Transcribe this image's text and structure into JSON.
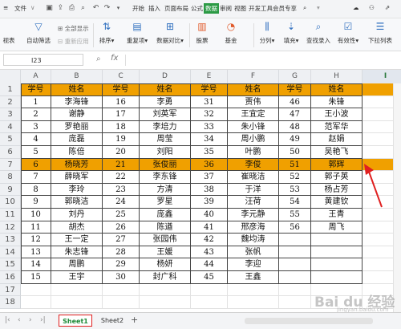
{
  "menubar": {
    "file": "文件",
    "tabs": [
      "开始",
      "插入",
      "页面布局",
      "公式",
      "数据",
      "审阅",
      "视图",
      "开发工具",
      "会员专享"
    ],
    "active_tab": "数据"
  },
  "ribbon": {
    "left_cut": "视表",
    "items": [
      {
        "label": "自动筛选",
        "icon": "filter-icon"
      },
      {
        "label": "排序",
        "icon": "sort-icon"
      },
      {
        "label": "重复项",
        "icon": "duplicate-icon"
      },
      {
        "label": "数据对比",
        "icon": "compare-icon"
      },
      {
        "label": "股票",
        "icon": "stock-icon"
      },
      {
        "label": "基金",
        "icon": "fund-icon"
      },
      {
        "label": "分列",
        "icon": "split-icon"
      },
      {
        "label": "填充",
        "icon": "fill-icon"
      },
      {
        "label": "查找录入",
        "icon": "lookup-icon"
      },
      {
        "label": "有效性",
        "icon": "validity-icon"
      },
      {
        "label": "下拉列表",
        "icon": "dropdown-list-icon"
      }
    ],
    "small": {
      "show_all": "全部显示",
      "reapply": "重新应用"
    }
  },
  "formula_bar": {
    "cell_ref": "I23",
    "fx": "fx",
    "value": ""
  },
  "columns": [
    "A",
    "B",
    "C",
    "D",
    "E",
    "F",
    "G",
    "H",
    "I"
  ],
  "selected_column": "I",
  "rows": [
    "1",
    "2",
    "3",
    "4",
    "5",
    "6",
    "7",
    "8",
    "9",
    "10",
    "11",
    "12",
    "13",
    "14",
    "15",
    "16",
    "17",
    "18"
  ],
  "table": {
    "header": [
      "学号",
      "姓名",
      "学号",
      "姓名",
      "学号",
      "姓名",
      "学号",
      "姓名"
    ],
    "body": [
      [
        "1",
        "李海锋",
        "16",
        "李勇",
        "31",
        "贾伟",
        "46",
        "朱锋"
      ],
      [
        "2",
        "谢静",
        "17",
        "刘英军",
        "32",
        "王宜定",
        "47",
        "王小波"
      ],
      [
        "3",
        "罗艳丽",
        "18",
        "李培力",
        "33",
        "朱小锋",
        "48",
        "范军华"
      ],
      [
        "4",
        "庞磊",
        "19",
        "周莹",
        "34",
        "周小鹏",
        "49",
        "赵娟"
      ],
      [
        "5",
        "陈倍",
        "20",
        "刘阳",
        "35",
        "叶鹏",
        "50",
        "吴艳飞"
      ],
      [
        "6",
        "杨晓芳",
        "21",
        "张俊丽",
        "36",
        "李俊",
        "51",
        "郭辉"
      ],
      [
        "7",
        "薛晓军",
        "22",
        "李东锋",
        "37",
        "崔晓洁",
        "52",
        "郭子英"
      ],
      [
        "8",
        "李玲",
        "23",
        "方清",
        "38",
        "于洋",
        "53",
        "杨占芳"
      ],
      [
        "9",
        "郭晓洁",
        "24",
        "罗星",
        "39",
        "汪荷",
        "54",
        "黄建钦"
      ],
      [
        "10",
        "刘丹",
        "25",
        "庞鑫",
        "40",
        "李元静",
        "55",
        "王青"
      ],
      [
        "11",
        "胡杰",
        "26",
        "陈遒",
        "41",
        "邢彦海",
        "56",
        "周飞"
      ],
      [
        "12",
        "王一定",
        "27",
        "张园伟",
        "42",
        "魏均涛",
        "",
        ""
      ],
      [
        "13",
        "朱志锋",
        "28",
        "王媛",
        "43",
        "张帆",
        "",
        ""
      ],
      [
        "14",
        "周鹏",
        "29",
        "杨妍",
        "44",
        "李迎",
        "",
        ""
      ],
      [
        "15",
        "王宇",
        "30",
        "封广科",
        "45",
        "王鑫",
        "",
        ""
      ]
    ]
  },
  "highlight_row_index": 6,
  "colors": {
    "header_fill": "#f0a000",
    "accent": "#2b9a44",
    "arrow": "#e02020"
  },
  "sheets": [
    "Sheet1",
    "Sheet2"
  ],
  "active_sheet": "Sheet1",
  "watermark": {
    "brand": "Bai du 经验",
    "sub": "jingyan.baidu.com"
  }
}
